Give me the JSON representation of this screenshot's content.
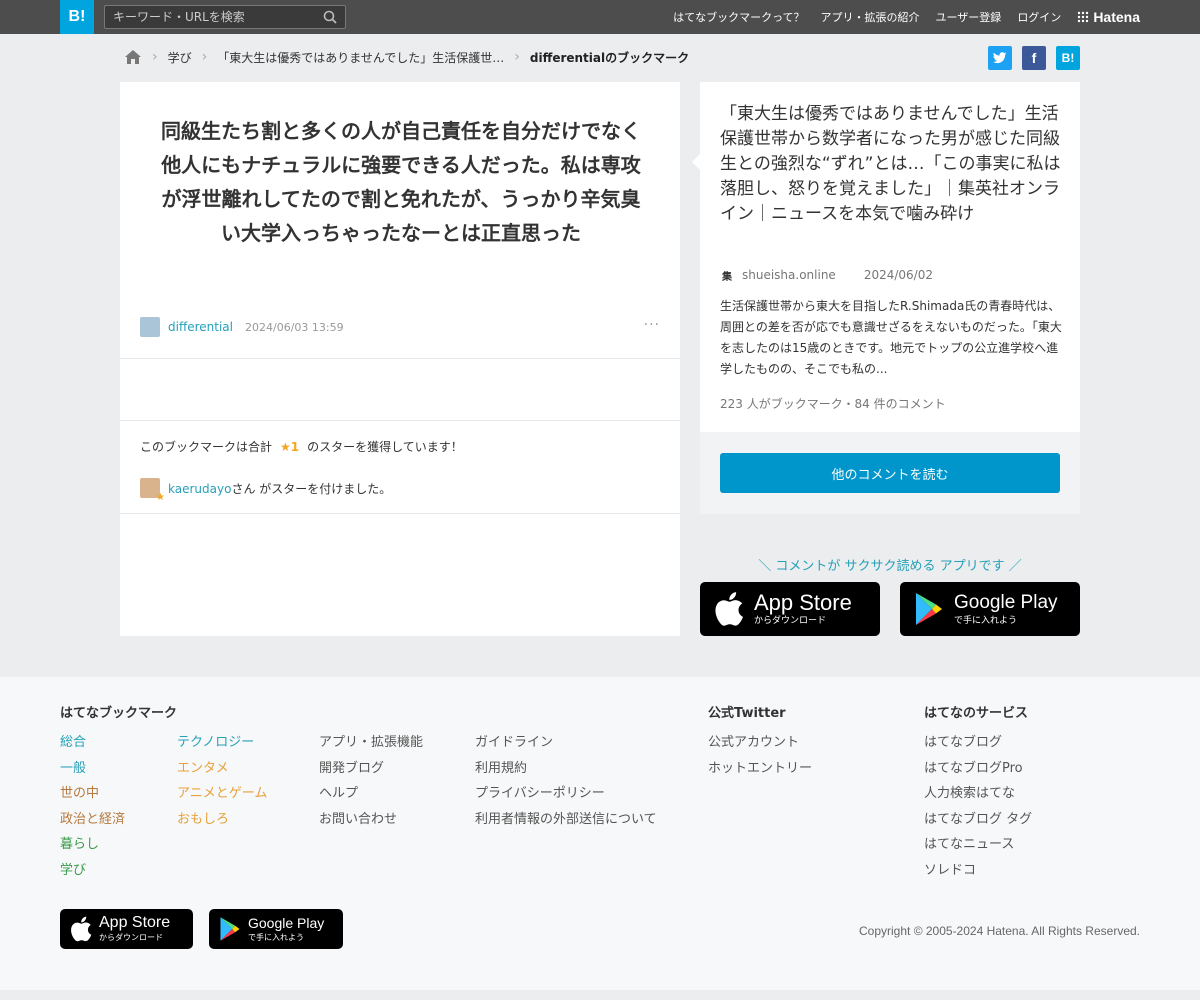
{
  "header": {
    "logo": "B!",
    "search_placeholder": "キーワード・URLを検索",
    "nav": [
      "はてなブックマークって？",
      "アプリ・拡張の紹介",
      "ユーザー登録",
      "ログイン"
    ],
    "brand": "Hatena"
  },
  "breadcrumb": {
    "items": [
      "学び",
      "「東大生は優秀ではありませんでした」生活保護世…"
    ],
    "current": "differentialのブックマーク"
  },
  "share": {
    "twitter": "t",
    "facebook": "f",
    "hatena": "B!"
  },
  "bookmark": {
    "comment": "同級生たち割と多くの人が自己責任を自分だけでなく他人にもナチュラルに強要できる人だった。私は専攻が浮世離れしてたので割と免れたが、うっかり辛気臭い大学入っちゃったなーとは正直思った",
    "user": "differential",
    "timestamp": "2024/06/03 13:59",
    "more": "···",
    "stars_prefix": "このブックマークは合計",
    "stars_count": "★1",
    "stars_suffix": "のスターを獲得しています！",
    "starrer_name": "kaerudayo",
    "starrer_suffix": "さん がスターを付けました。"
  },
  "entry": {
    "title": "「東大生は優秀ではありませんでした」生活保護世帯から数学者になった男が感じた同級生との強烈な“ずれ”とは…「この事実に私は落胆し、怒りを覚えました」｜集英社オンライン｜ニュースを本気で噛み砕け",
    "favicon": "集",
    "domain": "shueisha.online",
    "date": "2024/06/02",
    "description": "生活保護世帯から東大を目指したR.Shimada氏の青春時代は、周囲との差を否が応でも意識せざるをえないものだった。「東大を志したのは15歳のときです。地元でトップの公立進学校へ進学したものの、そこでも私の...",
    "counts": "223 人がブックマーク・84 件のコメント",
    "read_button": "他のコメントを読む"
  },
  "promo": {
    "text": "＼ コメントが サクサク読める アプリです ／",
    "appstore_big": "App Store",
    "appstore_small": "からダウンロード",
    "googleplay_big": "Google Play",
    "googleplay_small": "で手に入れよう"
  },
  "footer": {
    "col1_title": "はてなブックマーク",
    "categories_a": [
      {
        "label": "総合",
        "color": "#25a0b8"
      },
      {
        "label": "一般",
        "color": "#25a0b8"
      },
      {
        "label": "世の中",
        "color": "#b5793f"
      },
      {
        "label": "政治と経済",
        "color": "#b5793f"
      },
      {
        "label": "暮らし",
        "color": "#3b9a4a"
      },
      {
        "label": "学び",
        "color": "#3b9a4a"
      }
    ],
    "categories_b": [
      {
        "label": "テクノロジー",
        "color": "#25a0b8"
      },
      {
        "label": "エンタメ",
        "color": "#e8a13a"
      },
      {
        "label": "アニメとゲーム",
        "color": "#e8a13a"
      },
      {
        "label": "おもしろ",
        "color": "#e8a13a"
      }
    ],
    "links_c": [
      "アプリ・拡張機能",
      "開発ブログ",
      "ヘルプ",
      "お問い合わせ"
    ],
    "links_d": [
      "ガイドライン",
      "利用規約",
      "プライバシーポリシー",
      "利用者情報の外部送信について"
    ],
    "twitter_title": "公式Twitter",
    "twitter_links": [
      "公式アカウント",
      "ホットエントリー"
    ],
    "services_title": "はてなのサービス",
    "services": [
      "はてなブログ",
      "はてなブログPro",
      "人力検索はてな",
      "はてなブログ タグ",
      "はてなニュース",
      "ソレドコ"
    ],
    "copyright": "Copyright © 2005-2024 Hatena. All Rights Reserved."
  }
}
